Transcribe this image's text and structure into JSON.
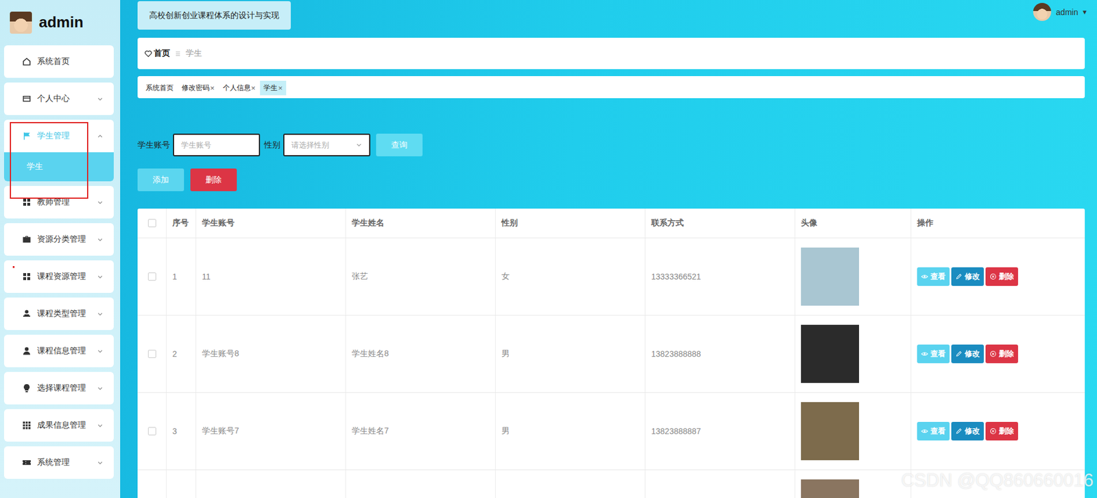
{
  "brand": {
    "name": "admin"
  },
  "header": {
    "title": "高校创新创业课程体系的设计与实现",
    "user": "admin",
    "menu_glyph": "▾"
  },
  "sidebar": {
    "items": [
      {
        "label": "系统首页",
        "expandable": false,
        "expanded": false,
        "selected": false,
        "children": []
      },
      {
        "label": "个人中心",
        "expandable": true,
        "expanded": false,
        "selected": false,
        "children": []
      },
      {
        "label": "学生管理",
        "expandable": true,
        "expanded": true,
        "selected": true,
        "children": [
          {
            "label": "学生",
            "selected": true
          }
        ]
      },
      {
        "label": "教师管理",
        "expandable": true,
        "expanded": false,
        "selected": false,
        "children": []
      },
      {
        "label": "资源分类管理",
        "expandable": true,
        "expanded": false,
        "selected": false,
        "children": []
      },
      {
        "label": "课程资源管理",
        "expandable": true,
        "expanded": false,
        "selected": false,
        "children": []
      },
      {
        "label": "课程类型管理",
        "expandable": true,
        "expanded": false,
        "selected": false,
        "children": []
      },
      {
        "label": "课程信息管理",
        "expandable": true,
        "expanded": false,
        "selected": false,
        "children": []
      },
      {
        "label": "选择课程管理",
        "expandable": true,
        "expanded": false,
        "selected": false,
        "children": []
      },
      {
        "label": "成果信息管理",
        "expandable": true,
        "expanded": false,
        "selected": false,
        "children": []
      },
      {
        "label": "系统管理",
        "expandable": true,
        "expanded": false,
        "selected": false,
        "children": []
      }
    ]
  },
  "breadcrumb": [
    {
      "label": "首页",
      "current": false
    },
    {
      "label": "学生",
      "current": true
    }
  ],
  "tags": [
    {
      "label": "系统首页",
      "closable": false,
      "selected": false
    },
    {
      "label": "修改密码",
      "closable": true,
      "selected": false
    },
    {
      "label": "个人信息",
      "closable": true,
      "selected": false
    },
    {
      "label": "学生",
      "closable": true,
      "selected": true
    }
  ],
  "tag_close": "×",
  "search": {
    "fields": [
      {
        "label": "学生账号",
        "placeholder": "学生账号",
        "kind": "input"
      },
      {
        "label": "性别",
        "placeholder": "请选择性别",
        "kind": "select"
      }
    ],
    "button": "查询"
  },
  "toolbar": [
    {
      "label": "添加",
      "color": "#5bd6ef"
    },
    {
      "label": "删除",
      "color": "#dc3545"
    }
  ],
  "table": {
    "select_all_checked": false,
    "columns": [
      "序号",
      "学生账号",
      "学生姓名",
      "性别",
      "联系方式",
      "头像",
      "操作"
    ],
    "actions": [
      {
        "label": "查看",
        "color": "#5ad3ef"
      },
      {
        "label": "修改",
        "color": "#1a8cc0"
      },
      {
        "label": "删除",
        "color": "#dc3545"
      }
    ],
    "rows": [
      {
        "index": "1",
        "account": "11",
        "name": "张艺",
        "gender": "女",
        "phone": "13333366521",
        "avatar_color": "#a9c6d2",
        "checked": false
      },
      {
        "index": "2",
        "account": "学生账号8",
        "name": "学生姓名8",
        "gender": "男",
        "phone": "13823888888",
        "avatar_color": "#2b2b2b",
        "checked": false
      },
      {
        "index": "3",
        "account": "学生账号7",
        "name": "学生姓名7",
        "gender": "男",
        "phone": "13823888887",
        "avatar_color": "#7d6b4c",
        "checked": false
      },
      {
        "index": "",
        "account": "",
        "name": "",
        "gender": "",
        "phone": "",
        "avatar_color": "#8a7560",
        "checked": false
      }
    ]
  },
  "watermark": "CSDN @QQ860660016"
}
